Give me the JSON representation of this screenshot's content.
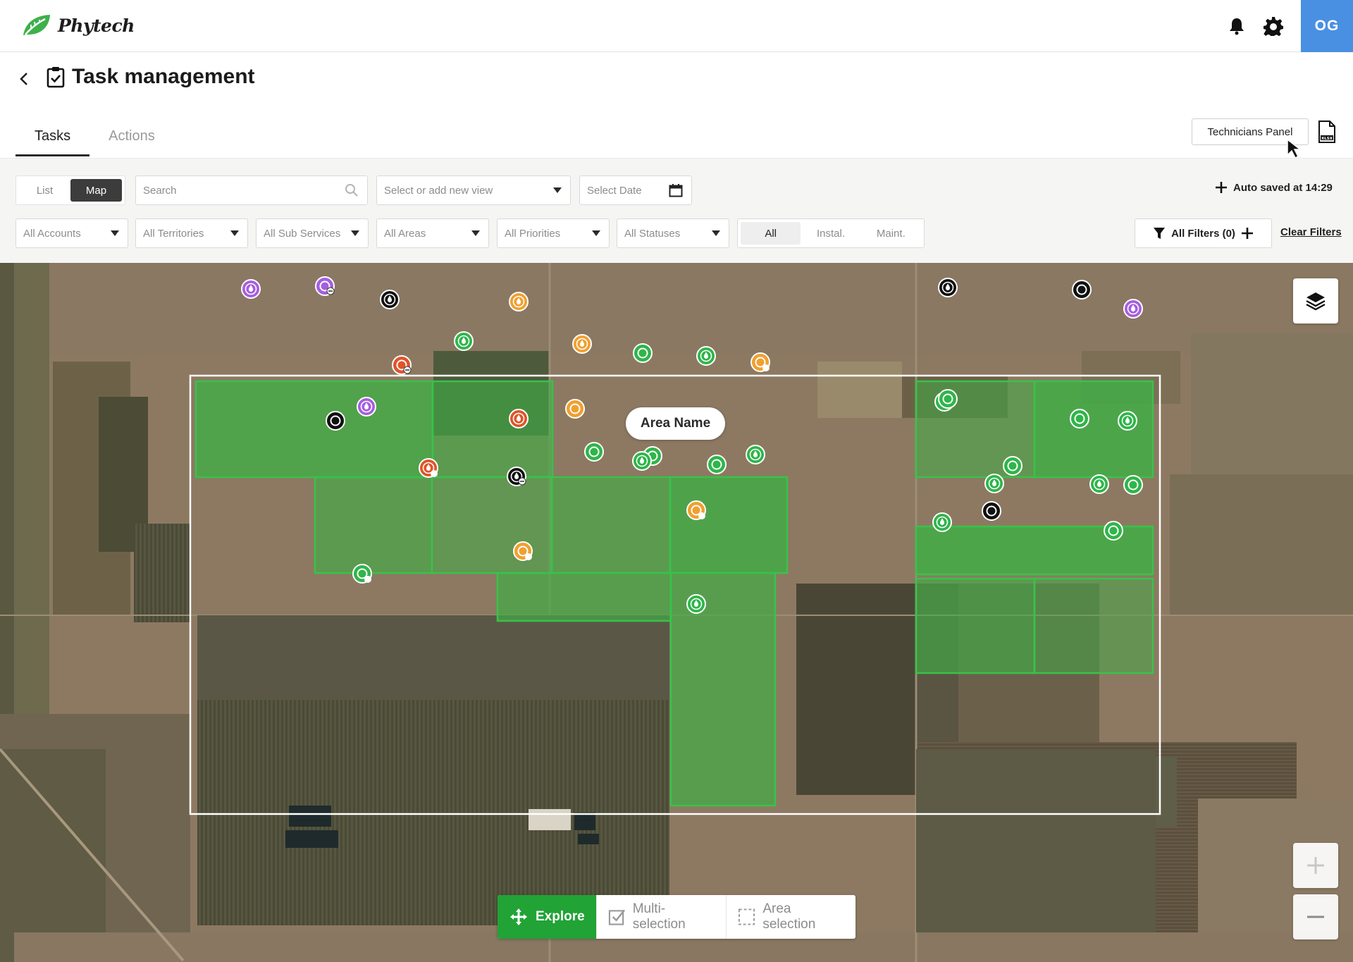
{
  "app": {
    "name": "Phytech",
    "user_initials": "OG"
  },
  "header": {
    "title": "Task management"
  },
  "tabs": [
    {
      "label": "Tasks",
      "active": true
    },
    {
      "label": "Actions",
      "active": false
    }
  ],
  "actions": {
    "technicians_panel": "Technicians Panel",
    "export_icon": "xlsx-file-icon"
  },
  "toolbar": {
    "view_toggle": [
      {
        "label": "List",
        "active": false
      },
      {
        "label": "Map",
        "active": true
      }
    ],
    "search_placeholder": "Search",
    "view_select": "Select or add new view",
    "date_placeholder": "Select Date",
    "autosave": "Auto saved at 14:29"
  },
  "filters": {
    "accounts": "All Accounts",
    "territories": "All Territories",
    "sub_services": "All Sub Services",
    "areas": "All Areas",
    "priorities": "All Priorities",
    "statuses": "All Statuses",
    "type_toggle": [
      {
        "label": "All",
        "active": true
      },
      {
        "label": "Instal.",
        "active": false
      },
      {
        "label": "Maint.",
        "active": false
      }
    ],
    "all_filters": "All Filters (0)",
    "clear": "Clear Filters"
  },
  "map": {
    "area_label": "Area Name",
    "modes": [
      {
        "label": "Explore",
        "active": true
      },
      {
        "label": "Multi-selection",
        "active": false
      },
      {
        "label": "Area selection",
        "active": false
      }
    ],
    "colors": {
      "green": "#2fb54a",
      "orange": "#f0a030",
      "red": "#e0542a",
      "purple": "#a65ee0",
      "black": "#111111"
    }
  }
}
